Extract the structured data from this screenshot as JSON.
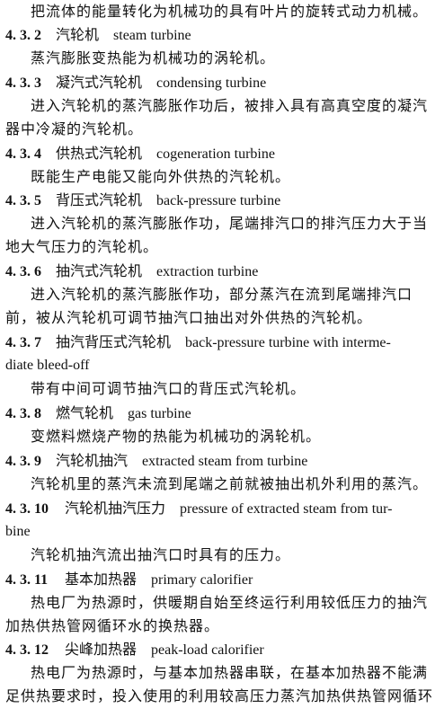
{
  "lines": [
    "把流体的能量转化为机械功的具有叶片的旋转式动力机械。",
    "蒸汽膨胀变热能为机械功的涡轮机。",
    "进入汽轮机的蒸汽膨胀作功后，被排入具有高真空度的凝汽",
    "器中冷凝的汽轮机。",
    "既能生产电能又能向外供热的汽轮机。",
    "进入汽轮机的蒸汽膨胀作功，尾端排汽口的排汽压力大于当",
    "地大气压力的汽轮机。",
    "进入汽轮机的蒸汽膨胀作功，部分蒸汽在流到尾端排汽口",
    "前，被从汽轮机可调节抽汽口抽出对外供热的汽轮机。",
    "diate bleed-off",
    "带有中间可调节抽汽口的背压式汽轮机。",
    "变燃料燃烧产物的热能为机械功的涡轮机。",
    "汽轮机里的蒸汽未流到尾端之前就被抽出机外利用的蒸汽。",
    "bine",
    "汽轮机抽汽流出抽汽口时具有的压力。",
    "热电厂为热源时，供暖期自始至终运行利用较低压力的抽汽",
    "加热供热管网循环水的换热器。",
    "热电厂为热源时，与基本加热器串联，在基本加热器不能满",
    "足供热要求时，投入使用的利用较高压力蒸汽加热供热管网循环"
  ],
  "terms": [
    {
      "num": "4. 3. 2",
      "cn": "汽轮机",
      "en": "steam turbine"
    },
    {
      "num": "4. 3. 3",
      "cn": "凝汽式汽轮机",
      "en": "condensing turbine"
    },
    {
      "num": "4. 3. 4",
      "cn": "供热式汽轮机",
      "en": "cogeneration turbine"
    },
    {
      "num": "4. 3. 5",
      "cn": "背压式汽轮机",
      "en": "back-pressure turbine"
    },
    {
      "num": "4. 3. 6",
      "cn": "抽汽式汽轮机",
      "en": "extraction turbine"
    },
    {
      "num": "4. 3. 7",
      "cn": "抽汽背压式汽轮机",
      "en": "back-pressure turbine with interme-"
    },
    {
      "num": "4. 3. 8",
      "cn": "燃气轮机",
      "en": "gas turbine"
    },
    {
      "num": "4. 3. 9",
      "cn": "汽轮机抽汽",
      "en": "extracted steam from turbine"
    },
    {
      "num": "4. 3. 10",
      "cn": "汽轮机抽汽压力",
      "en": "pressure of extracted steam from tur-"
    },
    {
      "num": "4. 3. 11",
      "cn": "基本加热器",
      "en": "primary calorifier"
    },
    {
      "num": "4. 3. 12",
      "cn": "尖峰加热器",
      "en": "peak-load calorifier"
    }
  ]
}
